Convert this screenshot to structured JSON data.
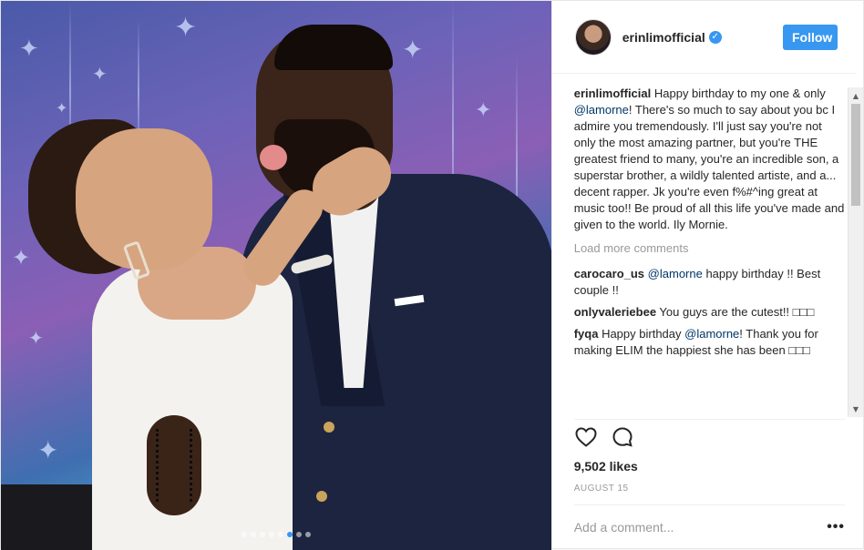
{
  "post": {
    "username": "erinlimofficial",
    "verified": true,
    "follow_label": "Follow",
    "caption": {
      "username": "erinlimofficial",
      "text_1": " Happy birthday to my one & only ",
      "mention": "@lamorne",
      "text_2": "! There's so much to say about you bc I admire you tremendously. I'll just say you're not only the most amazing partner, but you're THE greatest friend to many, you're an incredible son, a superstar brother, a wildly talented artiste, and a... decent rapper. Jk you're even f%#^ing great at music too!! Be proud of all this life you've made and given to the world. Ily Mornie."
    },
    "load_more_label": "Load more comments",
    "comments": [
      {
        "username": "carocaro_us",
        "mention": "@lamorne",
        "text": " happy birthday !! Best couple !!"
      },
      {
        "username": "onlyvaleriebee",
        "mention": "",
        "text": " You guys are the cutest!! □□□"
      },
      {
        "username": "fyqa",
        "mention": "@lamorne",
        "text_before": " Happy birthday ",
        "text": "! Thank you for making ELIM the happiest she has been □□□"
      }
    ],
    "likes": "9,502 likes",
    "date": "AUGUST 15",
    "add_comment_placeholder": "Add a comment...",
    "more_options": "•••",
    "carousel": {
      "count": 8,
      "active_index": 5
    }
  },
  "colors": {
    "accent": "#3897f0",
    "mention": "#003569",
    "muted": "#999999",
    "text": "#262626"
  },
  "icons": [
    "verified-badge-icon",
    "heart-icon",
    "comment-bubble-icon",
    "more-options-icon"
  ]
}
